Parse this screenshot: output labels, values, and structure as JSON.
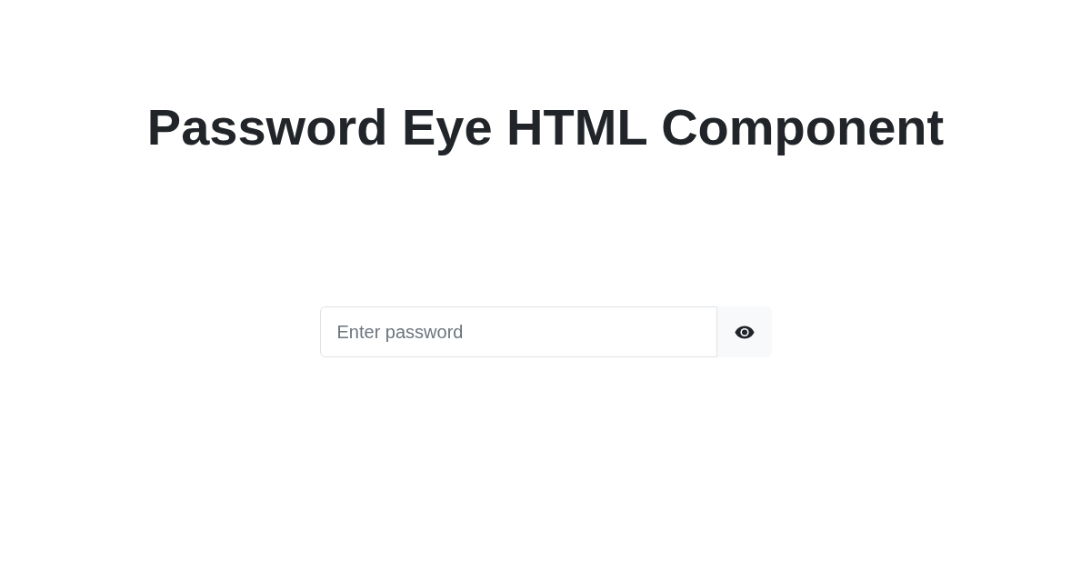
{
  "heading": "Password Eye HTML Component",
  "password_field": {
    "placeholder": "Enter password"
  }
}
